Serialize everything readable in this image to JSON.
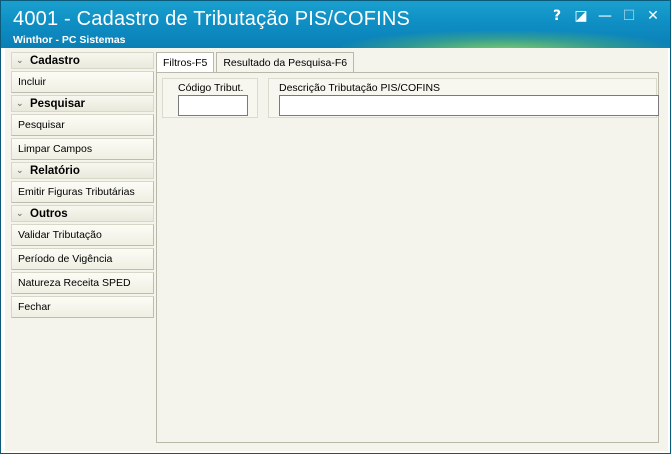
{
  "window": {
    "title": "4001 - Cadastro de Tributação PIS/COFINS",
    "subtitle": "Winthor - PC Sistemas",
    "buttons": {
      "help": "?",
      "restore": "◪",
      "minimize": "—",
      "maximize": "☐",
      "close": "✕"
    }
  },
  "sidebar": {
    "groups": [
      {
        "label": "Cadastro",
        "items": [
          "Incluir"
        ]
      },
      {
        "label": "Pesquisar",
        "items": [
          "Pesquisar",
          "Limpar Campos"
        ]
      },
      {
        "label": "Relatório",
        "items": [
          "Emitir Figuras Tributárias"
        ]
      },
      {
        "label": "Outros",
        "items": [
          "Validar Tributação",
          "Período de Vigência",
          "Natureza Receita SPED",
          "Fechar"
        ]
      }
    ]
  },
  "tabs": [
    {
      "label": "Filtros-F5",
      "active": true
    },
    {
      "label": "Resultado da Pesquisa-F6",
      "active": false
    }
  ],
  "filters": {
    "codigo_label": "Código Tribut.",
    "codigo_value": "",
    "descricao_label": "Descrição Tributação PIS/COFINS",
    "descricao_value": ""
  },
  "colors": {
    "titlebar": "#0f8fc4",
    "background": "#f4f4ec"
  }
}
